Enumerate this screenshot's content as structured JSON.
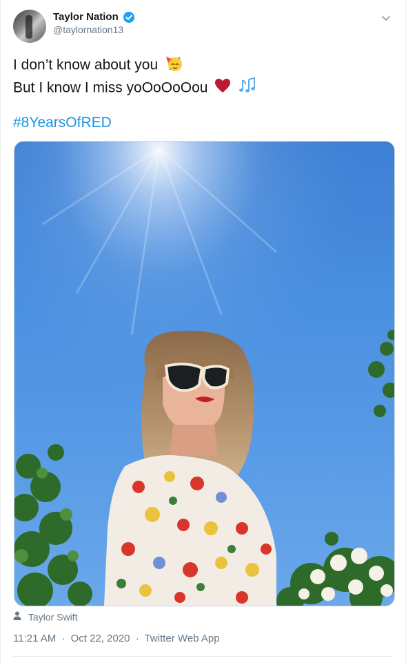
{
  "author": {
    "display_name": "Taylor Nation",
    "handle": "@taylornation13",
    "verified": true
  },
  "tweet": {
    "line1": "I don’t know about you",
    "line2": "But I know I miss yoOoOoOou",
    "line1_emoji": "partying-face-icon",
    "line2_emojis": [
      "red-heart-icon",
      "musical-notes-icon"
    ],
    "hashtag": "#8YearsOfRED"
  },
  "media": {
    "tagged_person": "Taylor Swift"
  },
  "meta": {
    "time": "11:21 AM",
    "date": "Oct 22, 2020",
    "source": "Twitter Web App",
    "separator": "·"
  },
  "colors": {
    "link": "#1b95e0",
    "verified": "#1da1f2",
    "secondary_text": "#657786"
  }
}
